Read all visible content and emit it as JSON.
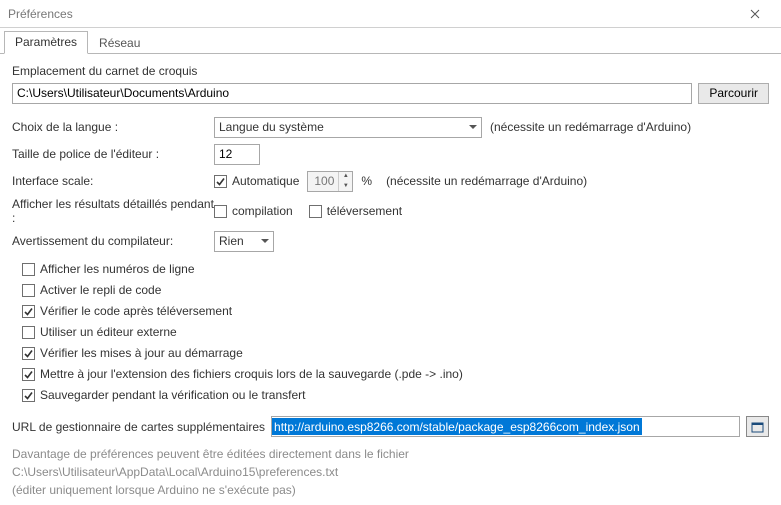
{
  "window": {
    "title": "Préférences"
  },
  "tabs": {
    "settings": "Paramètres",
    "network": "Réseau"
  },
  "sketchbook": {
    "label": "Emplacement du carnet de croquis",
    "path": "C:\\Users\\Utilisateur\\Documents\\Arduino",
    "browse": "Parcourir"
  },
  "language": {
    "label": "Choix de la langue :",
    "value": "Langue du système",
    "hint": "(nécessite un redémarrage d'Arduino)"
  },
  "editor_font": {
    "label": "Taille de police de l'éditeur :",
    "value": "12"
  },
  "interface_scale": {
    "label": "Interface scale:",
    "auto_label": "Automatique",
    "auto_checked": true,
    "value": "100",
    "unit": "%",
    "hint": "(nécessite un redémarrage d'Arduino)"
  },
  "verbose": {
    "label": "Afficher les résultats détaillés pendant :",
    "compilation_label": "compilation",
    "compilation_checked": false,
    "upload_label": "téléversement",
    "upload_checked": false
  },
  "compiler_warning": {
    "label": "Avertissement du compilateur:",
    "value": "Rien"
  },
  "options": {
    "line_numbers": {
      "label": "Afficher les numéros de ligne",
      "checked": false
    },
    "code_folding": {
      "label": "Activer le repli de code",
      "checked": false
    },
    "verify_after_upload": {
      "label": "Vérifier le code après téléversement",
      "checked": true
    },
    "external_editor": {
      "label": "Utiliser un éditeur externe",
      "checked": false
    },
    "check_updates": {
      "label": "Vérifier les mises à jour au démarrage",
      "checked": true
    },
    "update_extension": {
      "label": "Mettre à jour  l'extension des fichiers croquis lors de la sauvegarde (.pde -> .ino)",
      "checked": true
    },
    "save_on_verify": {
      "label": "Sauvegarder pendant la vérification ou le transfert",
      "checked": true
    }
  },
  "boards_url": {
    "label": "URL de gestionnaire de cartes supplémentaires",
    "value": "http://arduino.esp8266.com/stable/package_esp8266com_index.json"
  },
  "footnotes": {
    "line1": "Davantage de préférences peuvent être éditées directement dans le fichier",
    "line2": "C:\\Users\\Utilisateur\\AppData\\Local\\Arduino15\\preferences.txt",
    "line3": "(éditer uniquement lorsque Arduino ne s'exécute pas)"
  }
}
